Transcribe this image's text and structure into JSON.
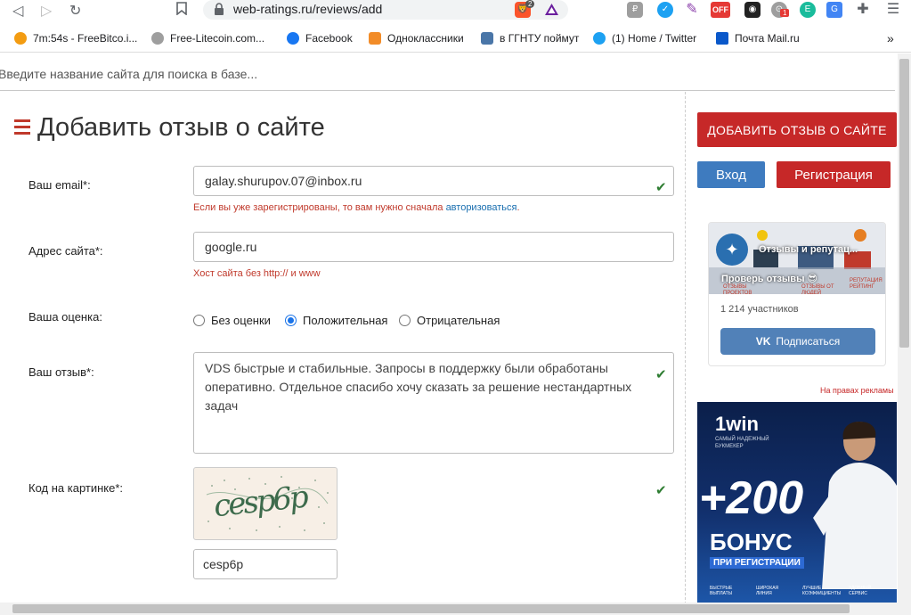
{
  "browser": {
    "url": "web-ratings.ru/reviews/add",
    "extension_badges": [
      "2",
      "OFF",
      "1"
    ],
    "bookmarks": [
      {
        "label": "7m:54s - FreeBitco.i...",
        "color": "#f39c12"
      },
      {
        "label": "Free-Litecoin.com...",
        "color": "#9e9e9e"
      },
      {
        "label": "Facebook",
        "color": "#1877f2"
      },
      {
        "label": "Одноклассники",
        "color": "#f28c28"
      },
      {
        "label": "в ГГНТУ поймут",
        "color": "#4a76a8"
      },
      {
        "label": "(1) Home / Twitter",
        "color": "#1da1f2"
      },
      {
        "label": "Почта Mail.ru",
        "color": "#0a58ca"
      }
    ],
    "more_bookmarks": "»"
  },
  "search": {
    "placeholder": "Введите название сайта для поиска в базе..."
  },
  "page": {
    "title": "Добавить отзыв о сайте"
  },
  "form": {
    "email_label": "Ваш email*:",
    "email_value": "galay.shurupov.07@inbox.ru",
    "email_hint_text": "Если вы уже зарегистрированы, то вам нужно сначала ",
    "email_hint_link": "авторизоваться",
    "email_hint_end": ".",
    "site_label": "Адрес сайта*:",
    "site_value": "google.ru",
    "site_hint": "Хост сайта без http:// и www",
    "rating_label": "Ваша оценка:",
    "rating_options": [
      "Без оценки",
      "Положительная",
      "Отрицательная"
    ],
    "rating_selected": "Положительная",
    "review_label": "Ваш отзыв*:",
    "review_value": "VDS быстрые и стабильные. Запросы в поддержку были обработаны оперативно. Отдельное спасибо хочу сказать за решение нестандартных задач",
    "captcha_label": "Код на картинке*:",
    "captcha_image_text": "cesp6p",
    "captcha_value": "cesp6p",
    "check_glyph": "✔"
  },
  "sidebar": {
    "add_review_button": "ДОБАВИТЬ ОТЗЫВ О САЙТЕ",
    "login_button": "Вход",
    "register_button": "Регистрация",
    "vk": {
      "group_name": "Отзывы и репутац...",
      "slogan": "Проверь отзывы 😎",
      "cover_labels": [
        "ОТЗЫВЫ ПРОЕКТОВ",
        "ОТЗЫВЫ ОТ ЛЮДЕЙ",
        "РЕПУТАЦИЯ РЕЙТИНГ"
      ],
      "members": "1 214 участников",
      "subscribe_button": "Подписаться"
    },
    "ad_note": "На правах рекламы",
    "ad": {
      "brand": "1win",
      "tagline": "САМЫЙ НАДЕЖНЫЙ БУКМЕКЕР",
      "amount": "+200",
      "bonus": "БОНУС",
      "bonus_sub": "ПРИ РЕГИСТРАЦИИ",
      "footer": [
        "БЫСТРЫЕ ВЫПЛАТЫ",
        "ШИРОКАЯ ЛИНИЯ",
        "ЛУЧШИЕ КОЭФФИЦИЕНТЫ",
        "УДОБНЫЙ СЕРВИС"
      ]
    }
  }
}
